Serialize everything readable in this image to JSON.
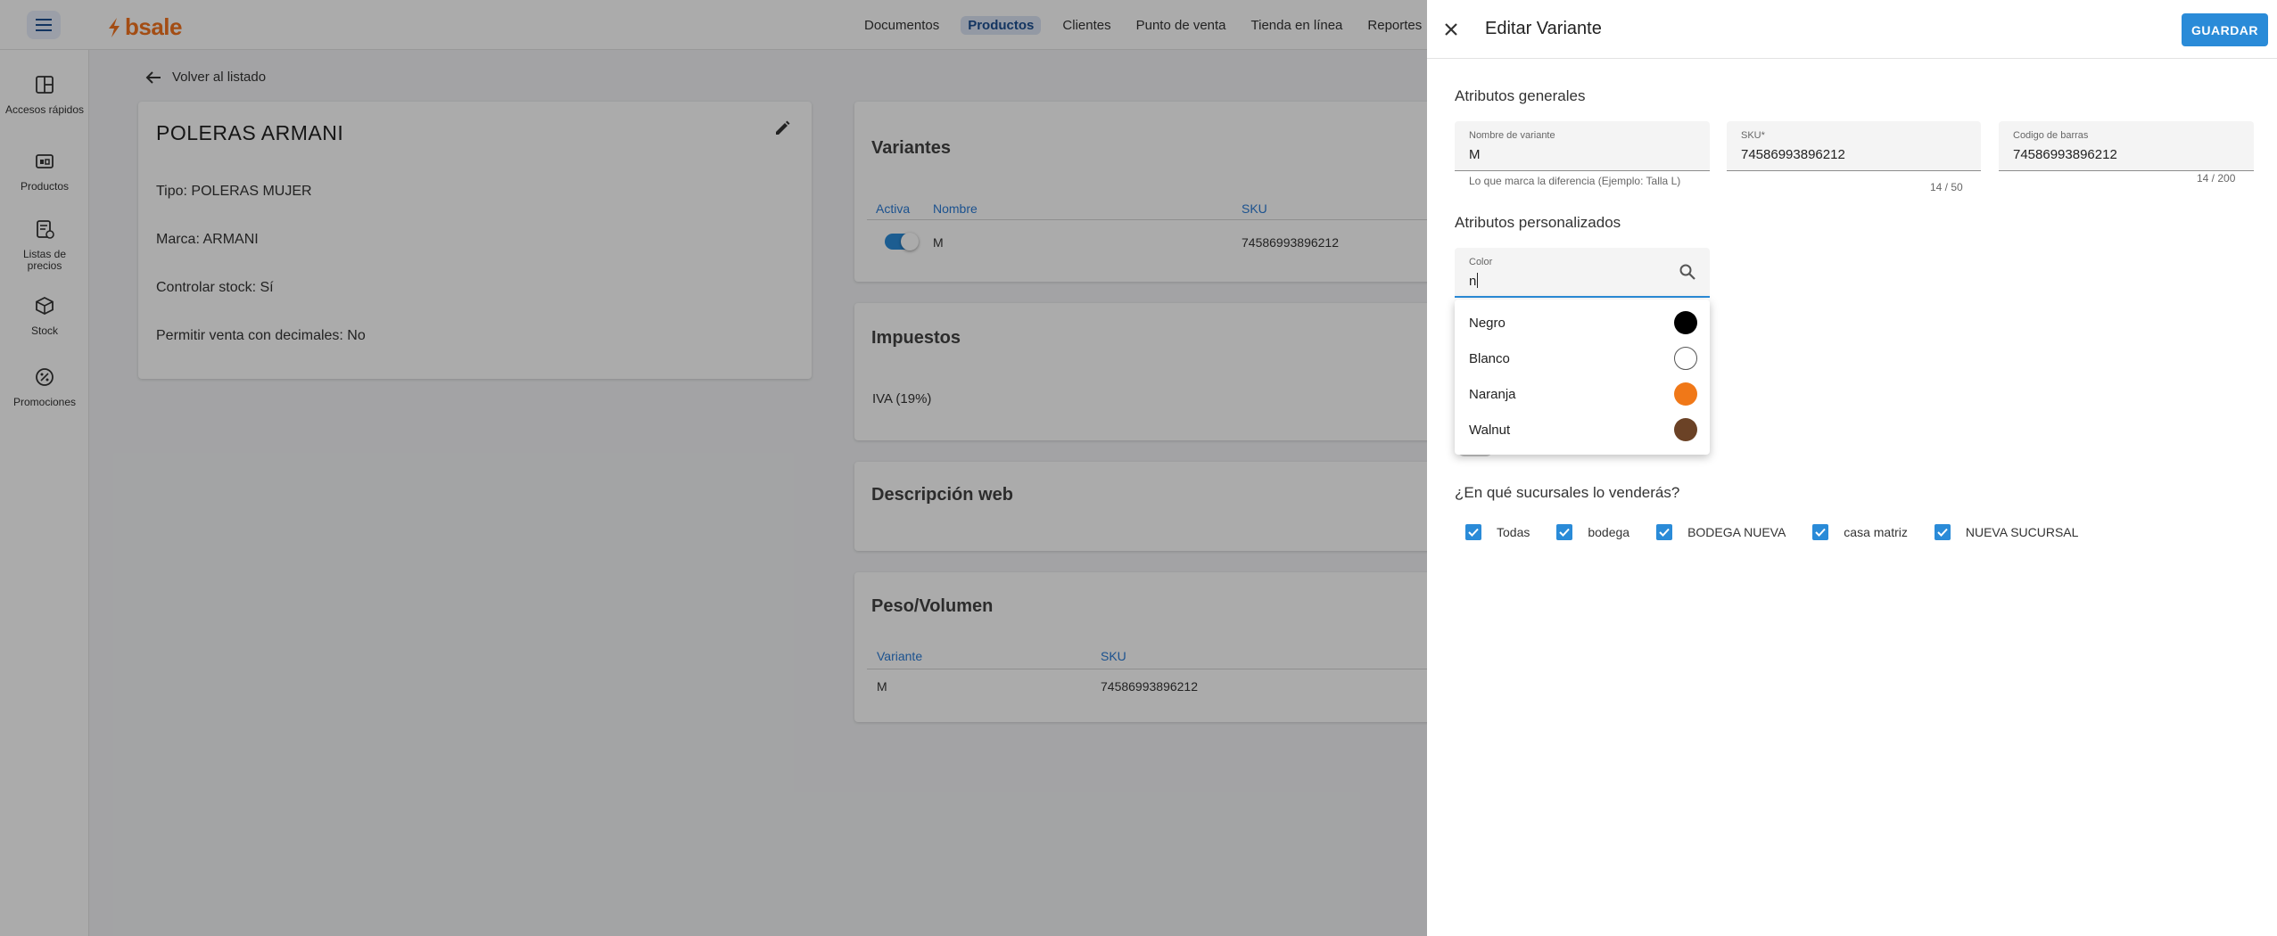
{
  "topnav": {
    "items": [
      "Documentos",
      "Productos",
      "Clientes",
      "Punto de venta",
      "Tienda en línea",
      "Reportes"
    ],
    "active_index": 1
  },
  "brand": {
    "name": "bsale",
    "color": "#f4741f"
  },
  "sidebar": {
    "items": [
      {
        "label": "Accesos rápidos",
        "icon": "dashboard-icon"
      },
      {
        "label": "Productos",
        "icon": "products-icon"
      },
      {
        "label": "Listas de precios",
        "icon": "price-list-icon"
      },
      {
        "label": "Stock",
        "icon": "box-icon"
      },
      {
        "label": "Promociones",
        "icon": "promotion-icon"
      }
    ]
  },
  "back_link": "Volver al listado",
  "product": {
    "title": "POLERAS ARMANI",
    "type": "Tipo: POLERAS MUJER",
    "brand": "Marca: ARMANI",
    "stock_control": "Controlar stock: Sí",
    "decimals": "Permitir venta con decimales: No"
  },
  "variants_card": {
    "title": "Variantes",
    "headers": [
      "Activa",
      "Nombre",
      "SKU"
    ],
    "rows": [
      {
        "active": true,
        "name": "M",
        "sku": "74586993896212"
      }
    ]
  },
  "taxes_card": {
    "title": "Impuestos",
    "value": "IVA (19%)"
  },
  "web_card": {
    "title": "Descripción web"
  },
  "weight_card": {
    "title": "Peso/Volumen",
    "headers": [
      "Variante",
      "SKU"
    ],
    "rows": [
      {
        "variant": "M",
        "sku": "74586993896212"
      }
    ]
  },
  "drawer": {
    "title": "Editar Variante",
    "save_label": "GUARDAR",
    "general_title": "Atributos generales",
    "fields": {
      "name": {
        "label": "Nombre de variante",
        "value": "M",
        "hint": "Lo que marca la diferencia (Ejemplo: Talla L)",
        "counter": "14 / 50"
      },
      "sku": {
        "label": "SKU*",
        "value": "74586993896212"
      },
      "barcode": {
        "label": "Codigo de barras",
        "value": "74586993896212",
        "counter": "14 / 200"
      }
    },
    "custom_title": "Atributos personalizados",
    "color_field": {
      "label": "Color",
      "value": "n"
    },
    "color_options": [
      {
        "label": "Negro",
        "color": "#000000"
      },
      {
        "label": "Blanco",
        "color": "#ffffff"
      },
      {
        "label": "Naranja",
        "color": "#f07818"
      },
      {
        "label": "Walnut",
        "color": "#6b4226"
      }
    ],
    "branches_title": "¿En qué sucursales lo venderás?",
    "branches": [
      {
        "label": "Todas",
        "checked": true
      },
      {
        "label": "bodega",
        "checked": true
      },
      {
        "label": "BODEGA NUEVA",
        "checked": true
      },
      {
        "label": "casa matriz",
        "checked": true
      },
      {
        "label": "NUEVA SUCURSAL",
        "checked": true
      }
    ]
  },
  "colors": {
    "accent": "#2a8bd8",
    "link": "#2a7bd5"
  }
}
